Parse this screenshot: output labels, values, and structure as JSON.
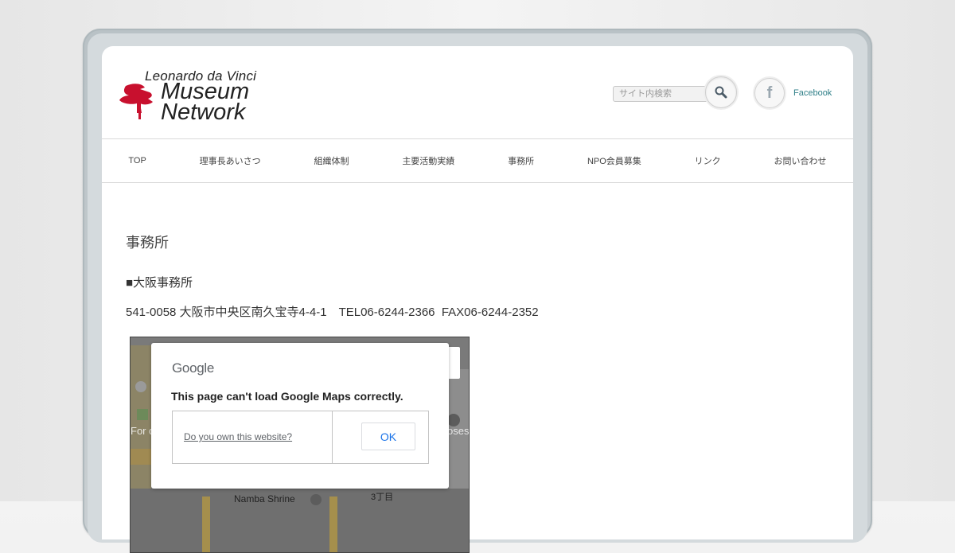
{
  "logo": {
    "line1": "Leonardo da Vinci",
    "line2": "Museum",
    "line3": "Network"
  },
  "header": {
    "search_placeholder": "サイト内検索",
    "facebook_label": "Facebook"
  },
  "nav": {
    "items": [
      "TOP",
      "理事長あいさつ",
      "組織体制",
      "主要活動実績",
      "事務所",
      "NPO会員募集",
      "リンク",
      "お問い合わせ"
    ]
  },
  "content": {
    "heading": "事務所",
    "office_title": "■大阪事務所",
    "address": "541-0058 大阪市中央区南久宝寺4-4-1　TEL06-6244-2366  FAX06-6244-2352"
  },
  "map": {
    "google_logo": "Google",
    "error_message": "This page can't load Google Maps correctly.",
    "own_site_link": "Do you own this website?",
    "ok_button": "OK",
    "label_left": "For d",
    "label_right": "oses",
    "label_shrine": "Namba Shrine",
    "label_chome": "3丁目"
  },
  "colors": {
    "facebook_link": "#2f7f88",
    "logo_red": "#c8102e",
    "ok_blue": "#1a73e8"
  }
}
